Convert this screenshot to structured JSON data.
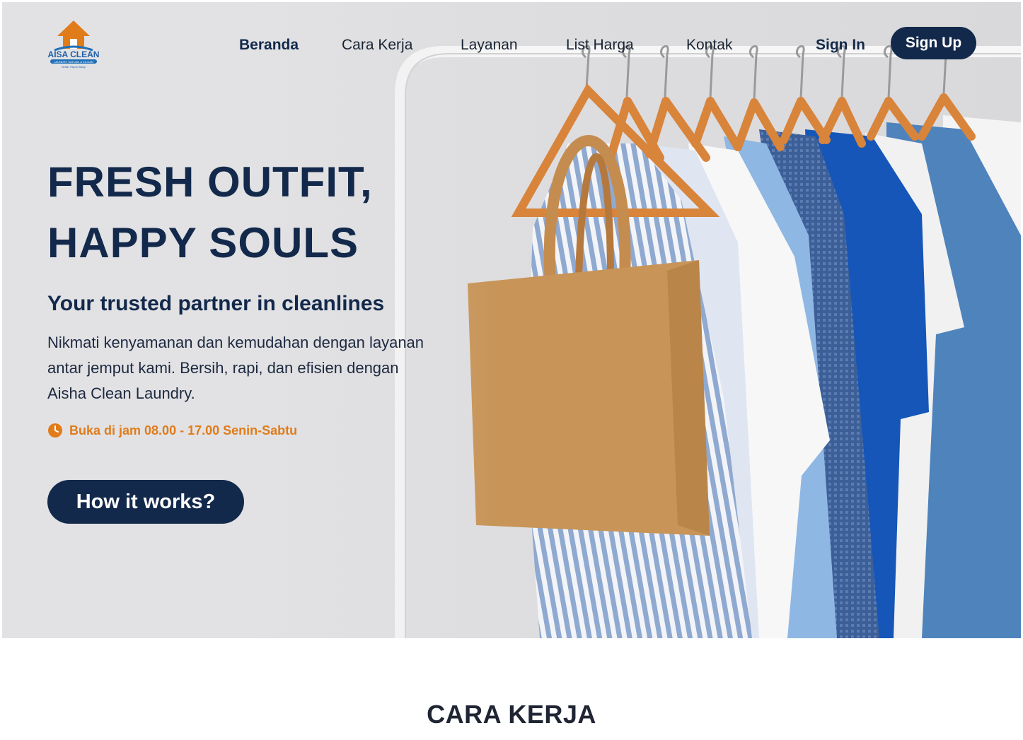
{
  "brand": {
    "name": "AISA CLEAN",
    "tagline": "LAUNDRY SATUAN & KILOAN",
    "slogan": "Bersih, Rapi & Wangi",
    "primary_color": "#13294b",
    "accent_color": "#e07c1a"
  },
  "nav": {
    "items": [
      {
        "label": "Beranda",
        "active": true
      },
      {
        "label": "Cara Kerja",
        "active": false
      },
      {
        "label": "Layanan",
        "active": false
      },
      {
        "label": "List Harga",
        "active": false
      },
      {
        "label": "Kontak",
        "active": false
      }
    ],
    "sign_in": "Sign In",
    "sign_up": "Sign Up"
  },
  "hero": {
    "headline_line1": "FRESH OUTFIT,",
    "headline_line2": "HAPPY SOULS",
    "subhead": "Your trusted partner in cleanlines",
    "desc_line1": "Nikmati kenyamanan dan kemudahan dengan layanan",
    "desc_line2": "antar jemput kami.  Bersih, rapi, dan efisien dengan",
    "desc_line3": "Aisha Clean Laundry.",
    "hours": "Buka di jam 08.00 - 17.00 Senin-Sabtu",
    "hours_icon": "clock-icon",
    "cta": "How it works?"
  },
  "section": {
    "title": "CARA KERJA"
  }
}
